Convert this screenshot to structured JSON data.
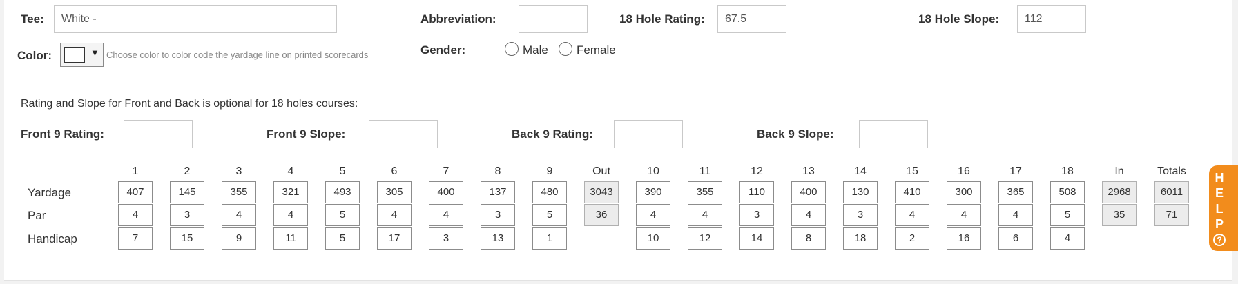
{
  "tee": {
    "label": "Tee:",
    "value": "White -"
  },
  "abbreviation": {
    "label": "Abbreviation:",
    "value": ""
  },
  "rating18": {
    "label": "18 Hole Rating:",
    "value": "67.5"
  },
  "slope18": {
    "label": "18 Hole Slope:",
    "value": "112"
  },
  "color": {
    "label": "Color:",
    "selected": "#ffffff",
    "hint": "Choose color to color code the yardage line on printed scorecards"
  },
  "gender": {
    "label": "Gender:",
    "options": [
      "Male",
      "Female"
    ],
    "selected": null
  },
  "optional_note": "Rating and Slope for Front and Back is optional for 18 holes courses:",
  "front9rating": {
    "label": "Front 9 Rating:",
    "value": ""
  },
  "front9slope": {
    "label": "Front 9 Slope:",
    "value": ""
  },
  "back9rating": {
    "label": "Back 9 Rating:",
    "value": ""
  },
  "back9slope": {
    "label": "Back 9 Slope:",
    "value": ""
  },
  "scorecard": {
    "headers": [
      "1",
      "2",
      "3",
      "4",
      "5",
      "6",
      "7",
      "8",
      "9",
      "Out",
      "10",
      "11",
      "12",
      "13",
      "14",
      "15",
      "16",
      "17",
      "18",
      "In",
      "Totals"
    ],
    "rows": [
      {
        "label": "Yardage",
        "values": [
          "407",
          "145",
          "355",
          "321",
          "493",
          "305",
          "400",
          "137",
          "480",
          "3043",
          "390",
          "355",
          "110",
          "400",
          "130",
          "410",
          "300",
          "365",
          "508",
          "2968",
          "6011"
        ]
      },
      {
        "label": "Par",
        "values": [
          "4",
          "3",
          "4",
          "4",
          "5",
          "4",
          "4",
          "3",
          "5",
          "36",
          "4",
          "4",
          "3",
          "4",
          "3",
          "4",
          "4",
          "4",
          "5",
          "35",
          "71"
        ]
      },
      {
        "label": "Handicap",
        "values": [
          "7",
          "15",
          "9",
          "11",
          "5",
          "17",
          "3",
          "13",
          "1",
          "",
          "10",
          "12",
          "14",
          "8",
          "18",
          "2",
          "16",
          "6",
          "4",
          "",
          ""
        ]
      }
    ]
  },
  "help": {
    "letters": [
      "H",
      "E",
      "L",
      "P"
    ],
    "icon": "question-circle-icon",
    "q": "?"
  },
  "colors": {
    "help_tab": "#f28c1c",
    "summary_cell": "#ececec"
  }
}
